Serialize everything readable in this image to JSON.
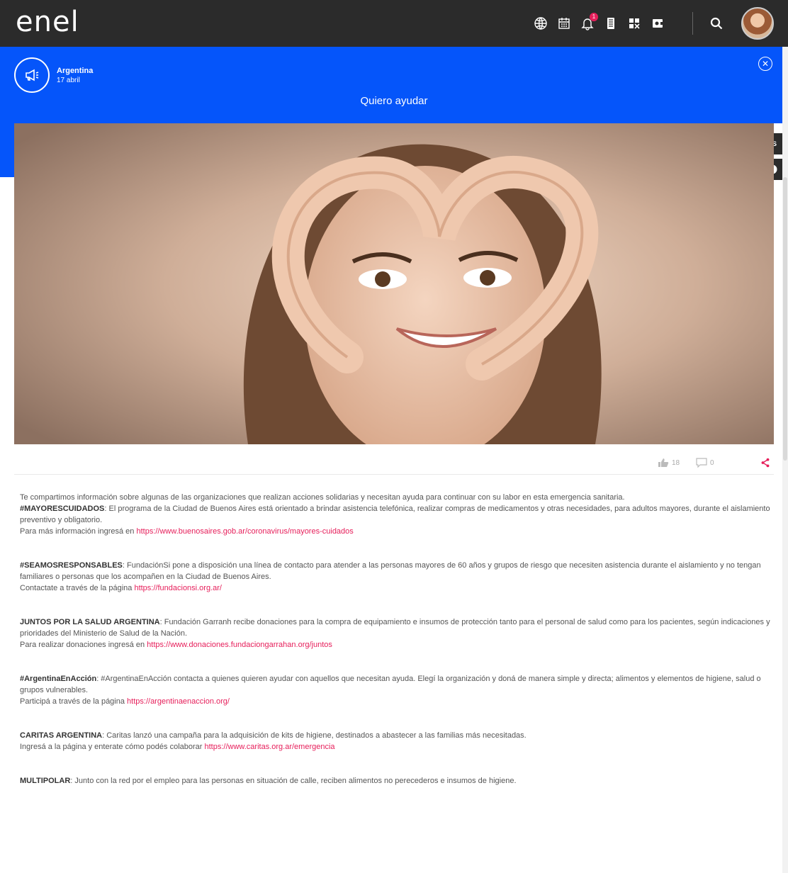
{
  "topbar": {
    "logo": "enel",
    "notification_count": "1"
  },
  "header": {
    "category": "Argentina",
    "date": "17 abril",
    "title": "Quiero ayudar"
  },
  "side_tabs": {
    "language": "ES",
    "info": "!"
  },
  "actions": {
    "likes": "18",
    "comments": "0"
  },
  "body": {
    "intro": "Te compartimos información sobre algunas de las organizaciones que realizan acciones solidarias y necesitan ayuda para continuar con su labor en esta emergencia sanitaria.",
    "blocks": [
      {
        "heading": "#MAYORESCUIDADOS",
        "text": ": El programa de la Ciudad de Buenos Aires está orientado a brindar asistencia telefónica, realizar compras de medicamentos y otras necesidades, para adultos mayores, durante el aislamiento preventivo y obligatorio.",
        "cta": "Para más información ingresá en ",
        "link": "https://www.buenosaires.gob.ar/coronavirus/mayores-cuidados"
      },
      {
        "heading": "#SEAMOSRESPONSABLES",
        "text": ": FundaciónSi pone a disposición una línea de contacto para atender a las personas mayores de 60 años y grupos de riesgo que necesiten asistencia durante el aislamiento y no tengan familiares o personas que los acompañen en la Ciudad de Buenos Aires.",
        "cta": "Contactate a través de la página ",
        "link": "https://fundacionsi.org.ar/"
      },
      {
        "heading": "JUNTOS POR LA SALUD ARGENTINA",
        "text": ": Fundación Garranh recibe donaciones para la compra de equipamiento e insumos de protección tanto para el personal de salud como para los pacientes, según indicaciones y prioridades del Ministerio de Salud de la Nación.",
        "cta": "Para realizar donaciones ingresá en ",
        "link": "https://www.donaciones.fundaciongarrahan.org/juntos"
      },
      {
        "heading": "#ArgentinaEnAcción",
        "text": ": #ArgentinaEnAcción contacta a quienes quieren ayudar con aquellos que necesitan ayuda. Elegí la organización y doná de manera simple y directa; alimentos y elementos de higiene, salud o grupos vulnerables.",
        "cta": "Participá a través de la página ",
        "link": "https://argentinaenaccion.org/"
      },
      {
        "heading": "CARITAS ARGENTINA",
        "text": ": Caritas lanzó una campaña para la adquisición de kits de higiene, destinados a abastecer a las familias más necesitadas.",
        "cta": "Ingresá a la página y enterate cómo podés colaborar ",
        "link": "https://www.caritas.org.ar/emergencia"
      },
      {
        "heading": "MULTIPOLAR",
        "text": ": Junto con la red por el empleo para las personas en situación de calle, reciben alimentos no perecederos e insumos de higiene.",
        "cta": "",
        "link": ""
      }
    ]
  }
}
